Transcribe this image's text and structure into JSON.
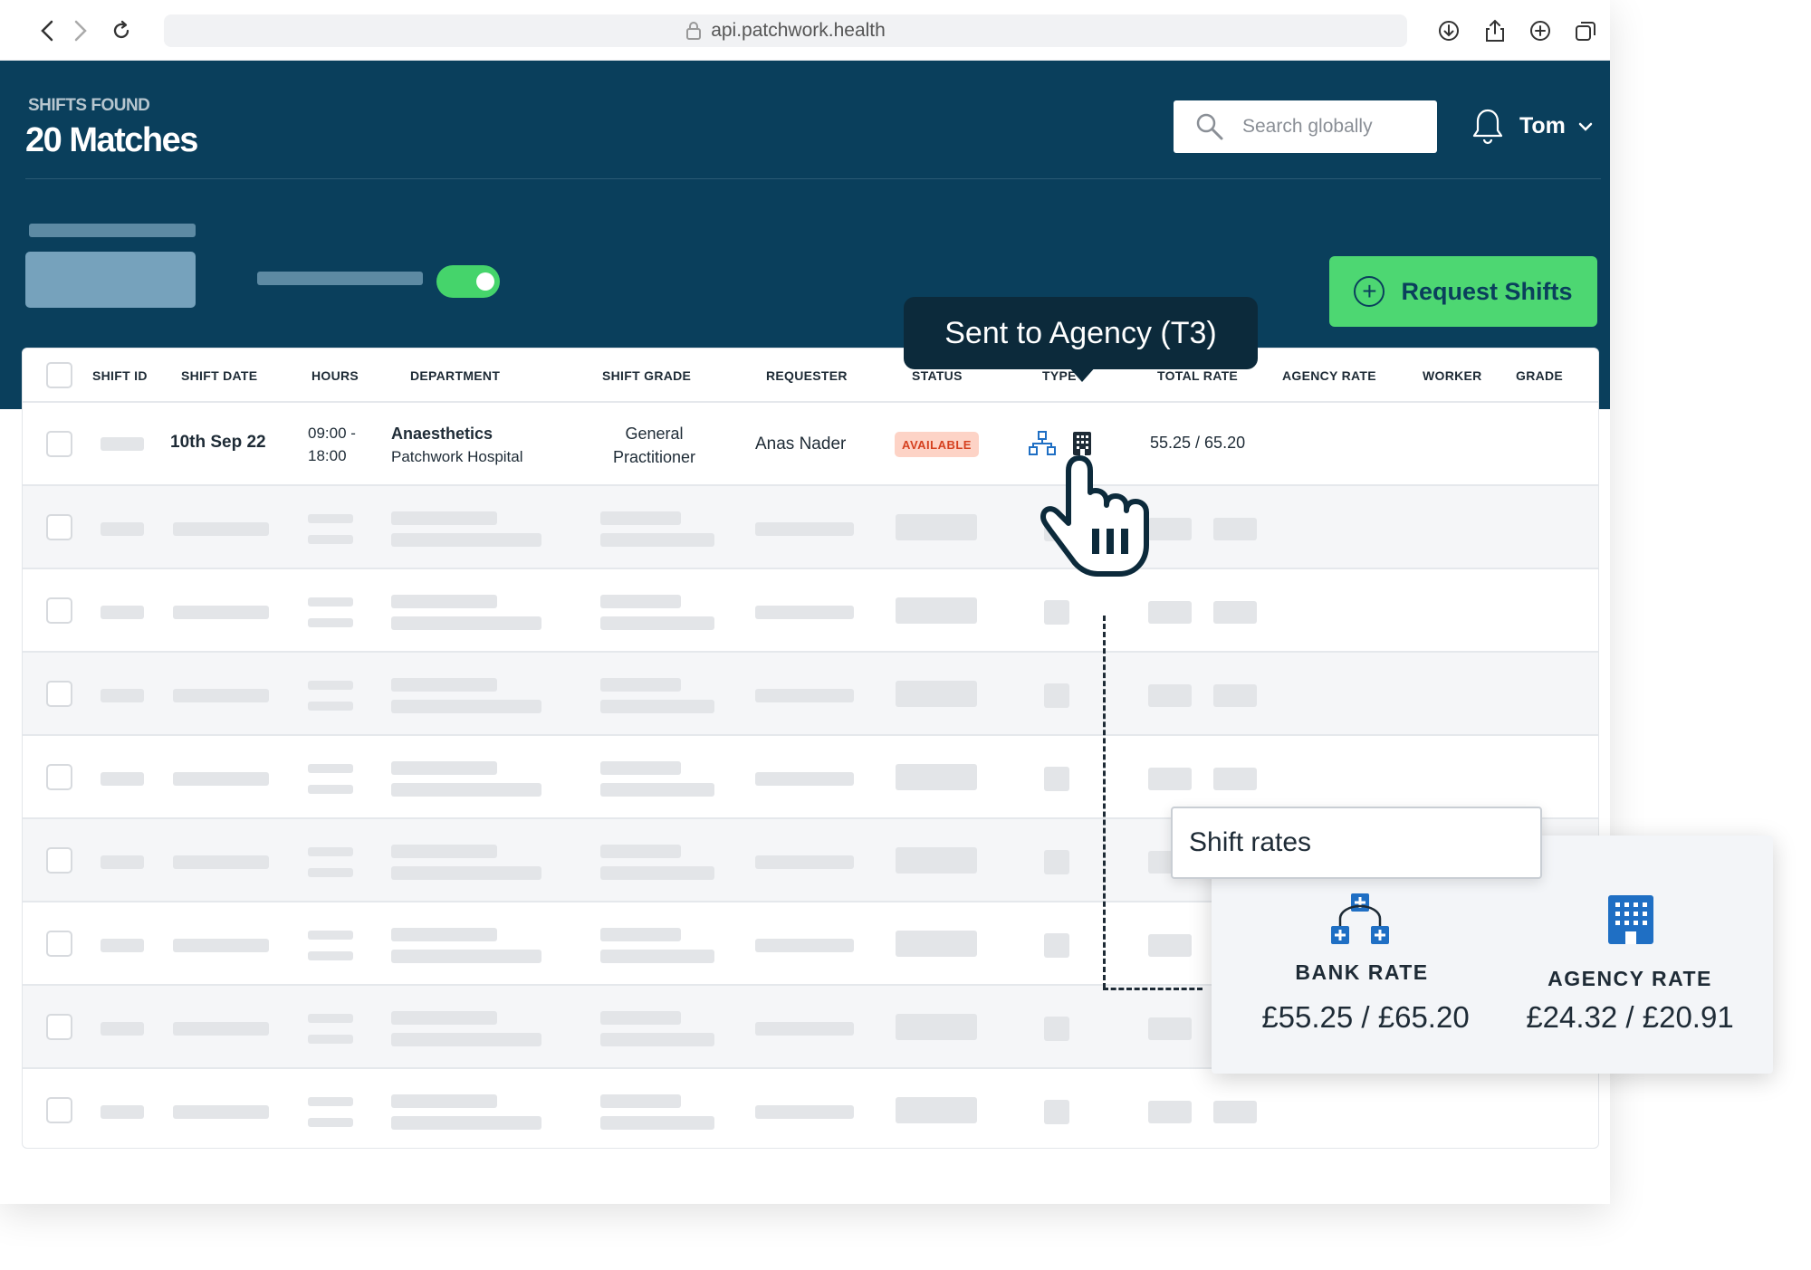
{
  "browser": {
    "url": "api.patchwork.health"
  },
  "header": {
    "label": "SHIFTS FOUND",
    "title": "20 Matches",
    "search_placeholder": "Search globally",
    "user_name": "Tom",
    "request_button": "Request Shifts"
  },
  "table": {
    "columns": [
      "SHIFT ID",
      "SHIFT DATE",
      "HOURS",
      "DEPARTMENT",
      "SHIFT GRADE",
      "REQUESTER",
      "STATUS",
      "TYPE",
      "TOTAL RATE",
      "AGENCY RATE",
      "WORKER",
      "GRADE"
    ],
    "row1": {
      "shift_date": "10th Sep 22",
      "hours_start": "09:00 -",
      "hours_end": "18:00",
      "department": "Anaesthetics",
      "hospital": "Patchwork Hospital",
      "grade_line1": "General",
      "grade_line2": "Practitioner",
      "requester": "Anas Nader",
      "status": "AVAILABLE",
      "total_rate": "55.25 / 65.20",
      "type_icons": [
        "bank-network-icon",
        "agency-building-icon"
      ]
    },
    "placeholder_rows": 8
  },
  "tooltip": {
    "text": "Sent to Agency (T3)"
  },
  "shift_rates": {
    "title": "Shift rates",
    "bank_label": "BANK RATE",
    "bank_value": "£55.25 / £65.20",
    "agency_label": "AGENCY RATE",
    "agency_value": "£24.32 / £20.91"
  },
  "colors": {
    "header_bg": "#0a3f5c",
    "accent_green": "#4dd772",
    "status_bg": "#fdd3c6",
    "status_text": "#d5401f",
    "icon_blue": "#1f6fc4"
  }
}
